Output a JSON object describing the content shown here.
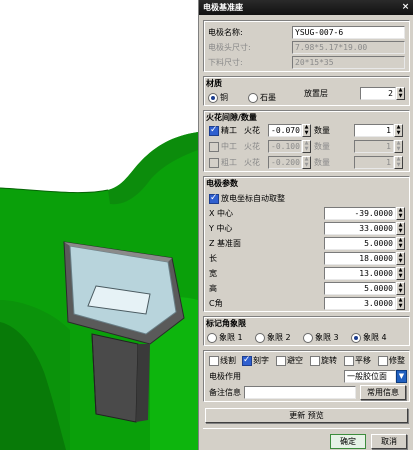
{
  "dialog": {
    "title": "电极基准座",
    "close_glyph": "×"
  },
  "info": {
    "name_label": "电极名称:",
    "name_value": "YSUG-007-6",
    "head_size_label": "电极头尺寸:",
    "head_size_value": "7.98*5.17*19.00",
    "stock_size_label": "下料尺寸:",
    "stock_size_value": "20*15*35"
  },
  "material": {
    "header": "材质",
    "options": [
      {
        "label": "铜",
        "selected": true
      },
      {
        "label": "石墨",
        "selected": false
      }
    ],
    "layer_label": "放置层",
    "layer_value": "2"
  },
  "spark": {
    "header": "火花间隙/数量",
    "spark_label": "火花",
    "qty_label": "数量",
    "rows": [
      {
        "label": "精工",
        "checked": true,
        "gap": "-0.070",
        "qty": "1",
        "enabled": true
      },
      {
        "label": "中工",
        "checked": false,
        "gap": "-0.100",
        "qty": "1",
        "enabled": false
      },
      {
        "label": "粗工",
        "checked": false,
        "gap": "-0.200",
        "qty": "1",
        "enabled": false
      }
    ]
  },
  "params": {
    "header": "电极参数",
    "auto_adjust_label": "放电坐标自动取整",
    "auto_adjust_checked": true,
    "rows": [
      {
        "label": "X 中心",
        "value": "-39.0000"
      },
      {
        "label": "Y 中心",
        "value": "33.0000"
      },
      {
        "label": "Z 基准面",
        "value": "5.0000"
      },
      {
        "label": "长",
        "value": "18.0000"
      },
      {
        "label": "宽",
        "value": "13.0000"
      },
      {
        "label": "高",
        "value": "5.0000"
      },
      {
        "label": "C角",
        "value": "3.0000"
      }
    ]
  },
  "quadrant": {
    "header": "标记角象限",
    "options": [
      {
        "label": "象限 1",
        "selected": false
      },
      {
        "label": "象限 2",
        "selected": false
      },
      {
        "label": "象限 3",
        "selected": false
      },
      {
        "label": "象限 4",
        "selected": true
      }
    ]
  },
  "options": {
    "checks": [
      {
        "label": "线割",
        "checked": false
      },
      {
        "label": "刻字",
        "checked": true
      },
      {
        "label": "避空",
        "checked": false
      },
      {
        "label": "旋转",
        "checked": false
      },
      {
        "label": "平移",
        "checked": false
      },
      {
        "label": "修整",
        "checked": false
      }
    ],
    "usage_label": "电极作用",
    "usage_value": "一般胶位面",
    "note_label": "备注信息",
    "note_value": "",
    "common_info_button": "常用信息"
  },
  "actions": {
    "update_preview": "更新 预览",
    "ok": "确定",
    "cancel": "取消"
  },
  "colors": {
    "viewport_green": "#0aa00a",
    "titlebar": "#1a1a1a",
    "dialog_bg": "#d4d0c8",
    "check_blue": "#2f5fcf"
  }
}
